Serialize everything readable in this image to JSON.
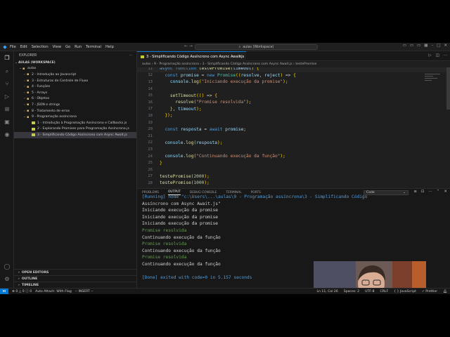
{
  "titlebar": {
    "menu": [
      "File",
      "Edit",
      "Selection",
      "View",
      "Go",
      "Run",
      "Terminal",
      "Help"
    ],
    "search_text": "aulas (Workspace)"
  },
  "sidebar": {
    "title": "EXPLORER",
    "workspace": "AULAS (WORKSPACE)",
    "root_folder": "aulas",
    "items": [
      {
        "label": "2 - Introdução ao Javascript",
        "type": "folder"
      },
      {
        "label": "3 - Estruturas de Controle de Fluxo",
        "type": "folder"
      },
      {
        "label": "4 - Funções",
        "type": "folder"
      },
      {
        "label": "5 - Arrays",
        "type": "folder"
      },
      {
        "label": "6 - Objetos",
        "type": "folder"
      },
      {
        "label": "7 - JSON e strings",
        "type": "folder"
      },
      {
        "label": "8 - Tratamento de erros",
        "type": "folder"
      },
      {
        "label": "9 - Programação assíncrona",
        "type": "folder-open"
      },
      {
        "label": "1 - Introdução à Programação Assíncrona e Callbacks.js",
        "type": "file"
      },
      {
        "label": "2 - Explorando Promises para Programação Assíncrona.js",
        "type": "file"
      },
      {
        "label": "3 - Simplificando Código Assíncrono com Async Await.js",
        "type": "file-active"
      }
    ],
    "sections": [
      "OPEN EDITORS",
      "OUTLINE",
      "TIMELINE"
    ]
  },
  "editor": {
    "tab_label": "3 - Simplificando Código Assíncrono com Async Await.js",
    "breadcrumb": "aulas › 9 - Programação assíncrona › 3 - Simplificando Código Assíncrono com Async Await.js › testePromise",
    "lines": [
      {
        "n": "11",
        "text": "async function testePromise(timeout) {"
      },
      {
        "n": "12",
        "text": "  const promise = new Promise((resolve, reject) => {"
      },
      {
        "n": "13",
        "text": "    console.log(\"Iniciando execução da promise\");"
      },
      {
        "n": "14",
        "text": ""
      },
      {
        "n": "15",
        "text": "    setTimeout(() => {"
      },
      {
        "n": "16",
        "text": "      resolve(\"Promise resolvida\");"
      },
      {
        "n": "17",
        "text": "    }, timeout);"
      },
      {
        "n": "18",
        "text": "  });"
      },
      {
        "n": "19",
        "text": ""
      },
      {
        "n": "20",
        "text": "  const resposta = await promise;"
      },
      {
        "n": "21",
        "text": ""
      },
      {
        "n": "22",
        "text": "  console.log(resposta);"
      },
      {
        "n": "23",
        "text": ""
      },
      {
        "n": "24",
        "text": "  console.log(\"Continuando execução da função\");"
      },
      {
        "n": "25",
        "text": "}"
      },
      {
        "n": "26",
        "text": ""
      },
      {
        "n": "27",
        "text": "testePromise(2000);"
      },
      {
        "n": "28",
        "text": "testePromise(1000);"
      }
    ]
  },
  "panel": {
    "tabs": [
      "PROBLEMS",
      "OUTPUT",
      "DEBUG CONSOLE",
      "TERMINAL",
      "PORTS"
    ],
    "active_tab": "OUTPUT",
    "output_channel": "Code",
    "output_lines": [
      "[Running] node \"c:\\Users\\...\\aulas\\9 - Programação assíncrona\\3 - Simplificando Código",
      "Assíncrono com Async Await.js\"",
      "Iniciando execução da promise",
      "Iniciando execução da promise",
      "Iniciando execução da promise",
      "Promise resolvida",
      "Continuando execução da função",
      "Promise resolvida",
      "Continuando execução da função",
      "Promise resolvida",
      "Continuando execução da função",
      "",
      "[Done] exited with code=0 in 5.157 seconds"
    ]
  },
  "status": {
    "errors": "0",
    "warnings": "0",
    "info": "0",
    "autoattach": "Auto Attach: With Flag",
    "mode": "-- INSERT --",
    "position": "Ln 11, Col 26",
    "spaces": "Spaces: 2",
    "encoding": "UTF-8",
    "eol": "CRLF",
    "language": "JavaScript",
    "formatter": "Prettier"
  },
  "colors": {
    "accent": "#0078d4",
    "keyword": "#569cd6",
    "control": "#c586c0",
    "function": "#dcdcaa",
    "string": "#ce9178",
    "variable": "#9cdcfe",
    "number": "#b5cea8",
    "class": "#4ec9b0",
    "output_blue": "#569cd6",
    "output_green": "#6a9955"
  }
}
